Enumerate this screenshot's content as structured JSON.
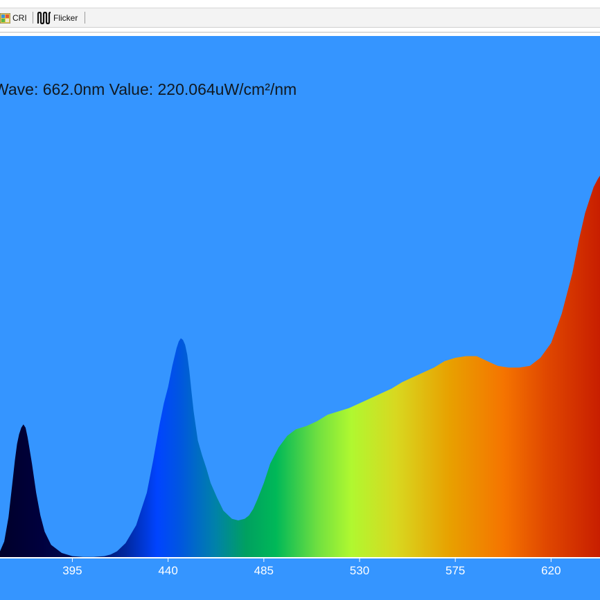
{
  "toolbar": {
    "cri_label": "CRI",
    "flicker_label": "Flicker"
  },
  "readout": {
    "text": "Wave: 662.0nm Value: 220.064uW/cm²/nm"
  },
  "colors": {
    "plot_background": "#3595ff",
    "axis_line": "#ffffff"
  },
  "chart_data": {
    "type": "area",
    "title": "",
    "xlabel": "",
    "ylabel": "",
    "x_unit": "nm",
    "y_unit": "uW/cm²/nm",
    "xlim": [
      361,
      643
    ],
    "ylim": [
      0,
      240
    ],
    "x_ticks": [
      395,
      440,
      485,
      530,
      575,
      620
    ],
    "grid": false,
    "legend": "none",
    "fill": "wavelength-spectrum-gradient",
    "x": [
      361,
      363,
      365,
      367,
      368,
      369,
      370,
      371,
      372,
      373,
      374,
      375,
      376,
      378,
      380,
      382,
      385,
      390,
      395,
      400,
      405,
      410,
      413,
      416,
      420,
      425,
      430,
      433,
      436,
      438,
      440,
      442,
      444,
      445,
      446,
      447,
      448,
      449,
      450,
      451,
      452,
      453,
      454,
      456,
      458,
      460,
      463,
      466,
      470,
      473,
      476,
      478,
      480,
      482,
      485,
      488,
      492,
      496,
      500,
      505,
      510,
      515,
      520,
      525,
      530,
      535,
      540,
      545,
      550,
      555,
      560,
      565,
      570,
      575,
      580,
      585,
      590,
      595,
      600,
      605,
      610,
      615,
      620,
      625,
      630,
      633,
      636,
      638,
      640,
      642,
      643
    ],
    "values": [
      4,
      10,
      25,
      48,
      60,
      70,
      76,
      80,
      82,
      80,
      74,
      66,
      58,
      40,
      26,
      16,
      8,
      3,
      1,
      0.5,
      0.5,
      1,
      2,
      4,
      9,
      20,
      40,
      60,
      82,
      95,
      105,
      118,
      129,
      133,
      135,
      134,
      131,
      125,
      115,
      102,
      90,
      81,
      72,
      63,
      55,
      46,
      37,
      29,
      24,
      23,
      24,
      26,
      30,
      36,
      46,
      58,
      68,
      75,
      79,
      81,
      84,
      88,
      90,
      92,
      95,
      98,
      101,
      104,
      108,
      111,
      114,
      117,
      121,
      123,
      124,
      124,
      121,
      118,
      117,
      117,
      118,
      123,
      132,
      150,
      175,
      195,
      212,
      220,
      228,
      233,
      235
    ]
  }
}
